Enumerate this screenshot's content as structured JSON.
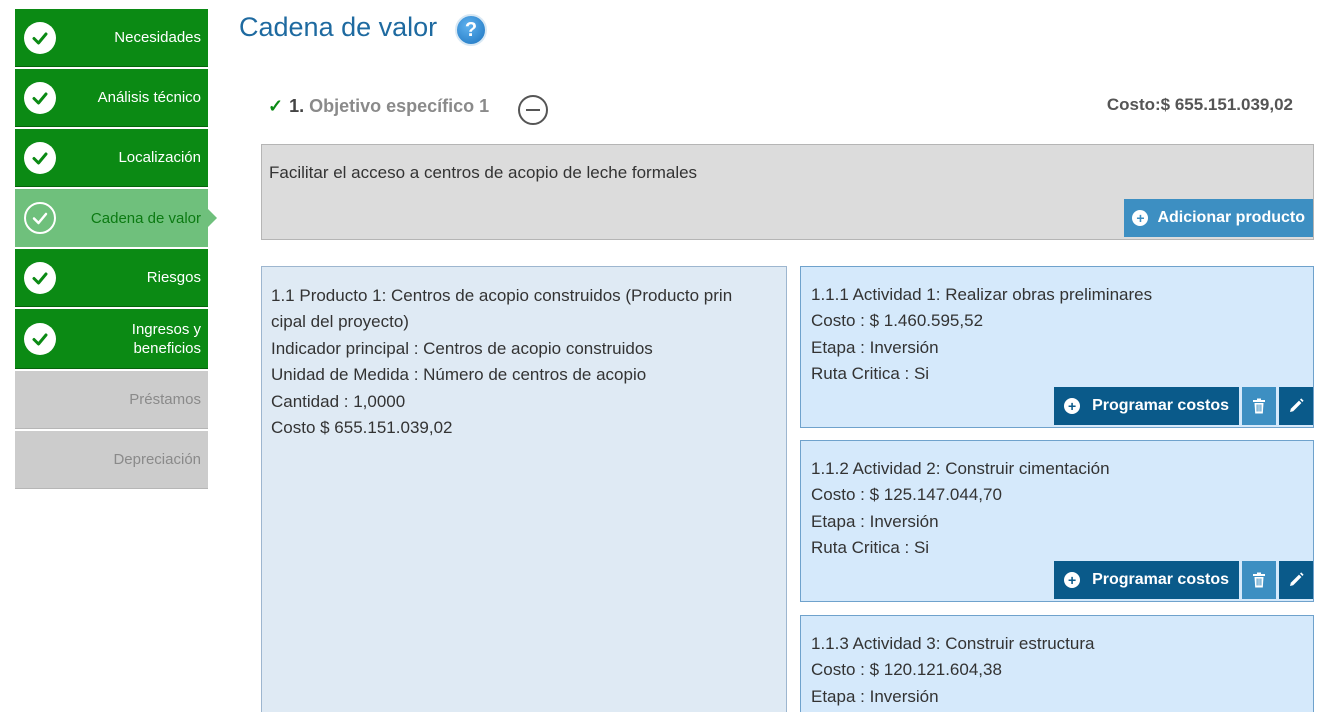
{
  "sidebar": {
    "items": [
      {
        "label": "Necesidades",
        "state": "done"
      },
      {
        "label": "Análisis técnico",
        "state": "done"
      },
      {
        "label": "Localización",
        "state": "done"
      },
      {
        "label": "Cadena de valor",
        "state": "active"
      },
      {
        "label": "Riesgos",
        "state": "done"
      },
      {
        "label": "Ingresos y beneficios",
        "state": "done"
      },
      {
        "label": "Préstamos",
        "state": "disabled"
      },
      {
        "label": "Depreciación",
        "state": "disabled"
      }
    ]
  },
  "header": {
    "title": "Cadena de valor",
    "help_glyph": "?"
  },
  "objective": {
    "number": "1.",
    "name": "Objetivo específico 1",
    "cost": "Costo:$ 655.151.039,02",
    "description": "Facilitar el acceso a centros de acopio de leche formales",
    "add_button_label": "Adicionar producto"
  },
  "product": {
    "lines": [
      "1.1 Producto 1: Centros de acopio construidos (Producto prin",
      "cipal del proyecto)",
      "Indicador principal : Centros de acopio construidos",
      "Unidad de Medida : Número de centros de acopio",
      "Cantidad : 1,0000",
      "Costo $ 655.151.039,02"
    ]
  },
  "activities": [
    {
      "title": "1.1.1 Actividad 1: Realizar obras preliminares",
      "cost": "Costo : $ 1.460.595,52",
      "stage": "Etapa : Inversión",
      "critical": "Ruta Critica : Si",
      "button_label": "Programar costos"
    },
    {
      "title": "1.1.2 Actividad 2: Construir cimentación",
      "cost": "Costo : $ 125.147.044,70",
      "stage": "Etapa : Inversión",
      "critical": "Ruta Critica : Si",
      "button_label": "Programar costos"
    },
    {
      "title": "1.1.3 Actividad 3: Construir estructura",
      "cost": "Costo : $ 120.121.604,38",
      "stage": "Etapa : Inversión"
    }
  ],
  "colors": {
    "done_green": "#0b8a14",
    "active_green": "#6fc07c",
    "disabled_gray": "#cccccc",
    "title_blue": "#1e6aa0",
    "button_dark_blue": "#0a5a8a",
    "button_light_blue": "#3d8fc2"
  },
  "icons": {
    "step_done": "check-icon",
    "help": "help-icon",
    "collapse": "minus-circle-icon",
    "add": "plus-circle-icon",
    "delete": "trash-icon",
    "edit": "pencil-icon"
  }
}
